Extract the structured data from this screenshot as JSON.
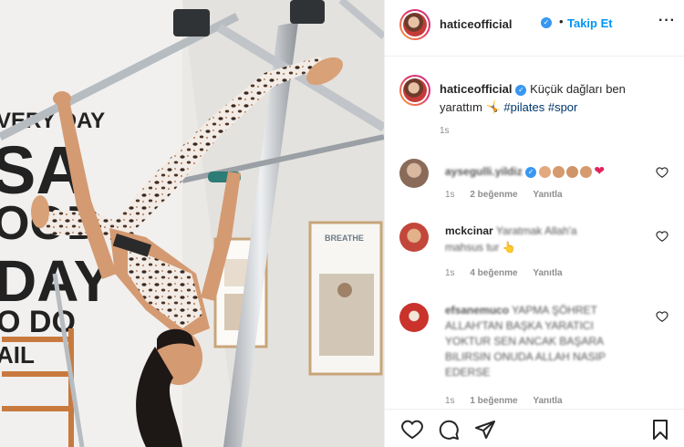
{
  "post": {
    "username": "haticeofficial",
    "verified_icon": "verified-badge-icon",
    "dot": "•",
    "follow_label": "Takip Et",
    "more_icon": "more-options-icon"
  },
  "caption": {
    "username": "haticeofficial",
    "text_line1": "Küçük dağları ben",
    "text_line2": "yarattım",
    "emoji": "🤸",
    "hashtags": [
      "#pilates",
      "#spor"
    ],
    "time": "1s"
  },
  "comments": [
    {
      "user": "aysegulli.yildiz",
      "text": "",
      "time": "1s",
      "likes": "2 beğenme",
      "reply": "Yanıtla"
    },
    {
      "user": "mckcinar",
      "text_line1": "Yaratmak Allah'a",
      "text_line2": "mahsus tur",
      "emoji": "👆",
      "time": "1s",
      "likes": "4 beğenme",
      "reply": "Yanıtla"
    },
    {
      "user": "efsanemuco",
      "lines": [
        "YAPMA ŞÖHRET",
        "ALLAH'TAN BAŞKA YARATICI",
        "YOKTUR SEN ANCAK BAŞARA",
        "BILIRSIN ONUDA ALLAH NASIP",
        "EDERSE"
      ],
      "time": "1s",
      "likes": "1 beğenme",
      "reply": "Yanıtla"
    }
  ],
  "photo_text": {
    "wall_line1": "VERY DAY",
    "wall_line2": "SA",
    "wall_line3": "OOD",
    "wall_line4": "DAY",
    "wall_line5": "O DO",
    "wall_line6": "AIL",
    "poster_label": "BREATHE"
  },
  "colors": {
    "accent": "#0095f6",
    "heart": "#ed4956",
    "text": "#262626",
    "muted": "#8e8e8e"
  }
}
